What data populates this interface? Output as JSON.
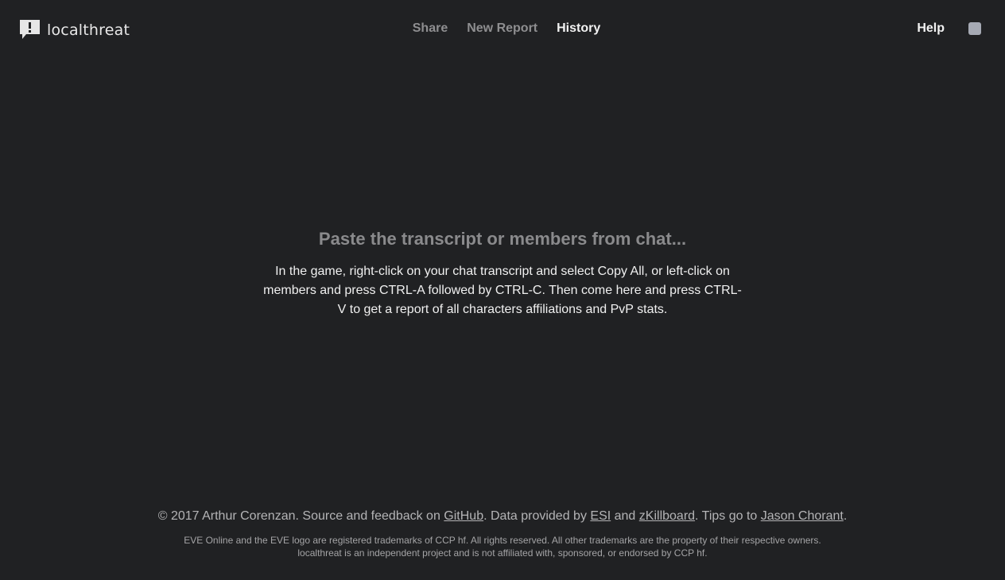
{
  "brand": {
    "name": "localthreat",
    "icon": "speech-bubble-exclamation-icon"
  },
  "nav": {
    "items": [
      {
        "label": "Share",
        "active": false
      },
      {
        "label": "New Report",
        "active": false
      },
      {
        "label": "History",
        "active": true
      }
    ],
    "help_label": "Help"
  },
  "main": {
    "title": "Paste the transcript or members from chat...",
    "description": "In the game, right-click on your chat transcript and select Copy All, or left-click on members and press CTRL-A followed by CTRL-C. Then come here and press CTRL-V to get a report of all characters affiliations and PvP stats."
  },
  "footer": {
    "copyright": "© 2017 Arthur Corenzan. Source and feedback on ",
    "github_label": "GitHub",
    "data_provided": ". Data provided by ",
    "esi_label": "ESI",
    "and_text": " and ",
    "zkillboard_label": "zKillboard",
    "tips_text": ". Tips go to ",
    "tips_name": "Jason Chorant",
    "end_period": ".",
    "legal": "EVE Online and the EVE logo are registered trademarks of CCP hf. All rights reserved. All other trademarks are the property of their respective owners. localthreat is an independent project and is not affiliated with, sponsored, or endorsed by CCP hf."
  },
  "colors": {
    "background": "#202123",
    "text_primary": "#f2f2f2",
    "text_muted": "#8e8e90",
    "user_avatar": "#a6aab4"
  }
}
